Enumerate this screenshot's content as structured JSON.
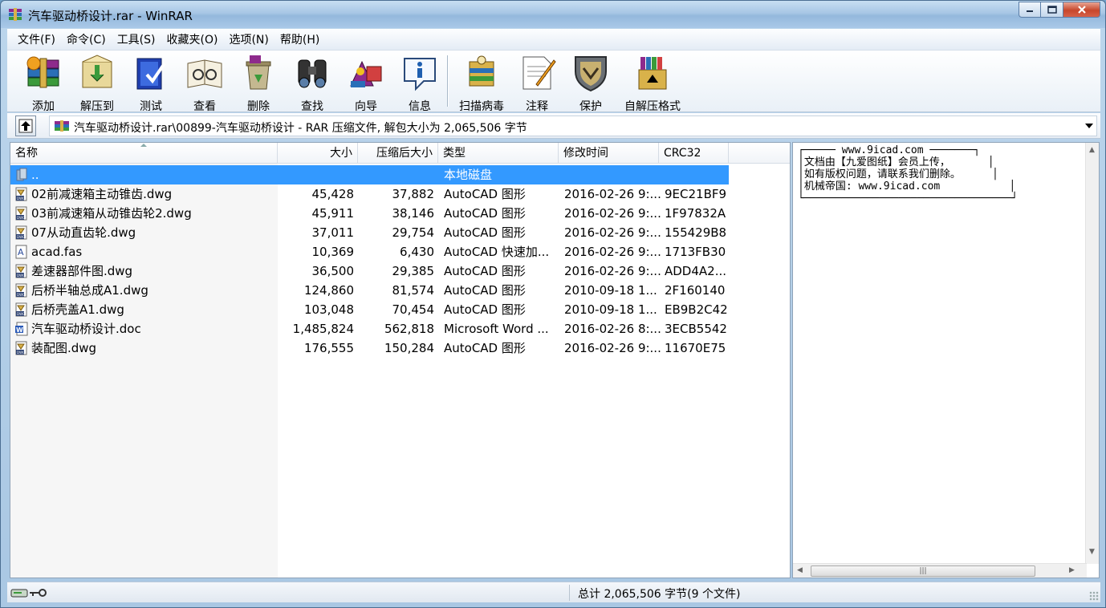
{
  "window": {
    "title": "汽车驱动桥设计.rar - WinRAR",
    "app_icon": "winrar-books-icon",
    "buttons": {
      "minimize": "minimize-icon",
      "maximize": "maximize-icon",
      "close": "close-icon"
    }
  },
  "menu": [
    "文件(F)",
    "命令(C)",
    "工具(S)",
    "收藏夹(O)",
    "选项(N)",
    "帮助(H)"
  ],
  "toolbar": [
    {
      "label": "添加",
      "icon": "add-archive-icon"
    },
    {
      "label": "解压到",
      "icon": "extract-to-icon"
    },
    {
      "label": "测试",
      "icon": "test-icon"
    },
    {
      "label": "查看",
      "icon": "view-icon"
    },
    {
      "label": "删除",
      "icon": "delete-icon"
    },
    {
      "label": "查找",
      "icon": "find-binoculars-icon"
    },
    {
      "label": "向导",
      "icon": "wizard-icon"
    },
    {
      "label": "信息",
      "icon": "info-icon"
    },
    {
      "label": "扫描病毒",
      "icon": "scan-virus-icon"
    },
    {
      "label": "注释",
      "icon": "comment-icon"
    },
    {
      "label": "保护",
      "icon": "protect-shield-icon"
    },
    {
      "label": "自解压格式",
      "icon": "sfx-icon"
    }
  ],
  "address": {
    "path": "汽车驱动桥设计.rar\\00899-汽车驱动桥设计 - RAR 压缩文件, 解包大小为 2,065,506 字节",
    "up_icon": "up-folder-icon"
  },
  "columns": {
    "name": "名称",
    "size": "大小",
    "packed": "压缩后大小",
    "type": "类型",
    "modified": "修改时间",
    "crc": "CRC32"
  },
  "files": [
    {
      "name": "..",
      "size": "",
      "packed": "",
      "type": "本地磁盘",
      "modified": "",
      "crc": "",
      "icon": "parent-folder-icon",
      "selected": true
    },
    {
      "name": "02前减速箱主动锥齿.dwg",
      "size": "45,428",
      "packed": "37,882",
      "type": "AutoCAD 图形",
      "modified": "2016-02-26 9:...",
      "crc": "9EC21BF9",
      "icon": "dwg-file-icon"
    },
    {
      "name": "03前减速箱从动锥齿轮2.dwg",
      "size": "45,911",
      "packed": "38,146",
      "type": "AutoCAD 图形",
      "modified": "2016-02-26 9:...",
      "crc": "1F97832A",
      "icon": "dwg-file-icon"
    },
    {
      "name": "07从动直齿轮.dwg",
      "size": "37,011",
      "packed": "29,754",
      "type": "AutoCAD 图形",
      "modified": "2016-02-26 9:...",
      "crc": "155429B8",
      "icon": "dwg-file-icon"
    },
    {
      "name": "acad.fas",
      "size": "10,369",
      "packed": "6,430",
      "type": "AutoCAD 快速加...",
      "modified": "2016-02-26 9:...",
      "crc": "1713FB30",
      "icon": "fas-file-icon"
    },
    {
      "name": "差速器部件图.dwg",
      "size": "36,500",
      "packed": "29,385",
      "type": "AutoCAD 图形",
      "modified": "2016-02-26 9:...",
      "crc": "ADD4A2...",
      "icon": "dwg-file-icon"
    },
    {
      "name": "后桥半轴总成A1.dwg",
      "size": "124,860",
      "packed": "81,574",
      "type": "AutoCAD 图形",
      "modified": "2010-09-18 1...",
      "crc": "2F160140",
      "icon": "dwg-file-icon"
    },
    {
      "name": "后桥壳盖A1.dwg",
      "size": "103,048",
      "packed": "70,454",
      "type": "AutoCAD 图形",
      "modified": "2010-09-18 1...",
      "crc": "EB9B2C42",
      "icon": "dwg-file-icon"
    },
    {
      "name": "汽车驱动桥设计.doc",
      "size": "1,485,824",
      "packed": "562,818",
      "type": "Microsoft Word ...",
      "modified": "2016-02-26 8:...",
      "crc": "3ECB5542",
      "icon": "word-doc-icon"
    },
    {
      "name": "装配图.dwg",
      "size": "176,555",
      "packed": "150,284",
      "type": "AutoCAD 图形",
      "modified": "2016-02-26 9:...",
      "crc": "11670E75",
      "icon": "dwg-file-icon"
    }
  ],
  "comment": {
    "text": "┌───── www.9icad.com ───────┐\n│文档由【九爱图纸】会员上传，      │\n│如有版权问题，请联系我们删除。     │\n│机械帝国: www.9icad.com           │\n└─────────────────────────────────┘"
  },
  "status": {
    "total": "总计 2,065,506 字节(9 个文件)",
    "icons": [
      "drive-icon",
      "key-icon"
    ]
  },
  "colors": {
    "selection": "#3399ff",
    "title_gradient": "#a7c6e5"
  }
}
